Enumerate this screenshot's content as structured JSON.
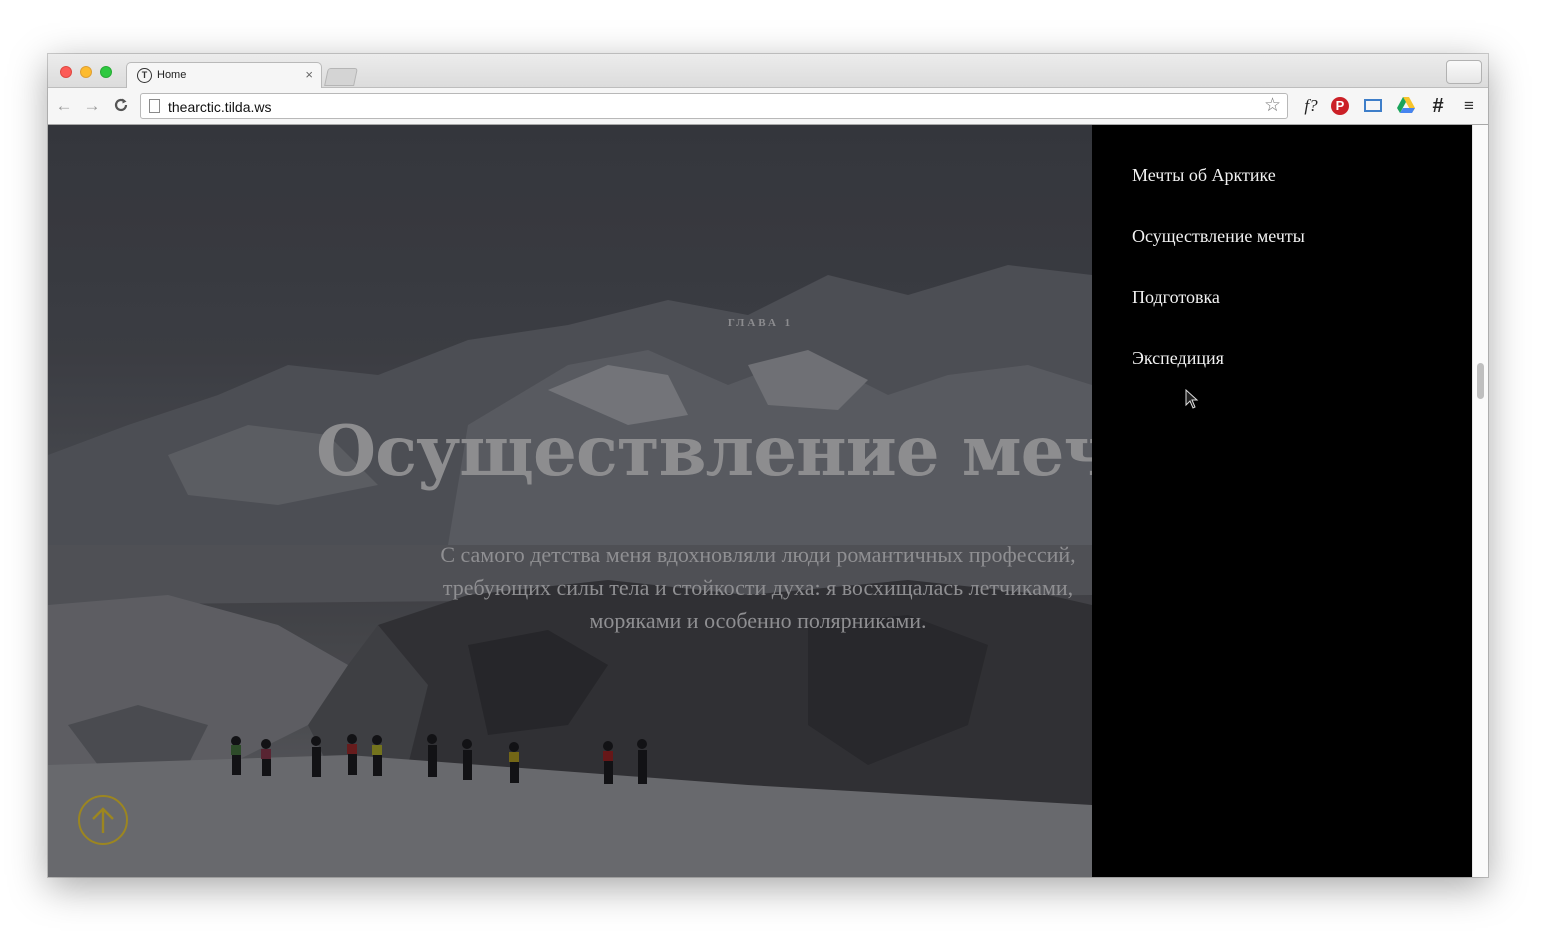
{
  "browser": {
    "tab_title": "Home",
    "tab_close": "×",
    "url": "thearctic.tilda.ws",
    "nav": {
      "back": "←",
      "forward": "→",
      "reload": "C"
    },
    "star": "☆",
    "extensions": {
      "font": "f?",
      "pinterest": "P",
      "hash": "#",
      "menu": "≡"
    }
  },
  "hero": {
    "chapter": "ГЛАВА 1",
    "title": "Осуществление мечты",
    "text_lines": [
      "С самого детства меня вдохновляли люди романтичных профессий,",
      "требующих силы тела и стойкости духа: я восхищалась летчиками,",
      "моряками и особенно полярниками."
    ]
  },
  "side_menu": {
    "items": [
      "Мечты об Арктике",
      "Осуществление мечты",
      "Подготовка",
      "Экспедиция"
    ]
  },
  "colors": {
    "menu_bg": "#000000",
    "menu_text": "#f2f2f2",
    "up_button": "#9c8620",
    "hero_text": "#8d8d8f"
  }
}
